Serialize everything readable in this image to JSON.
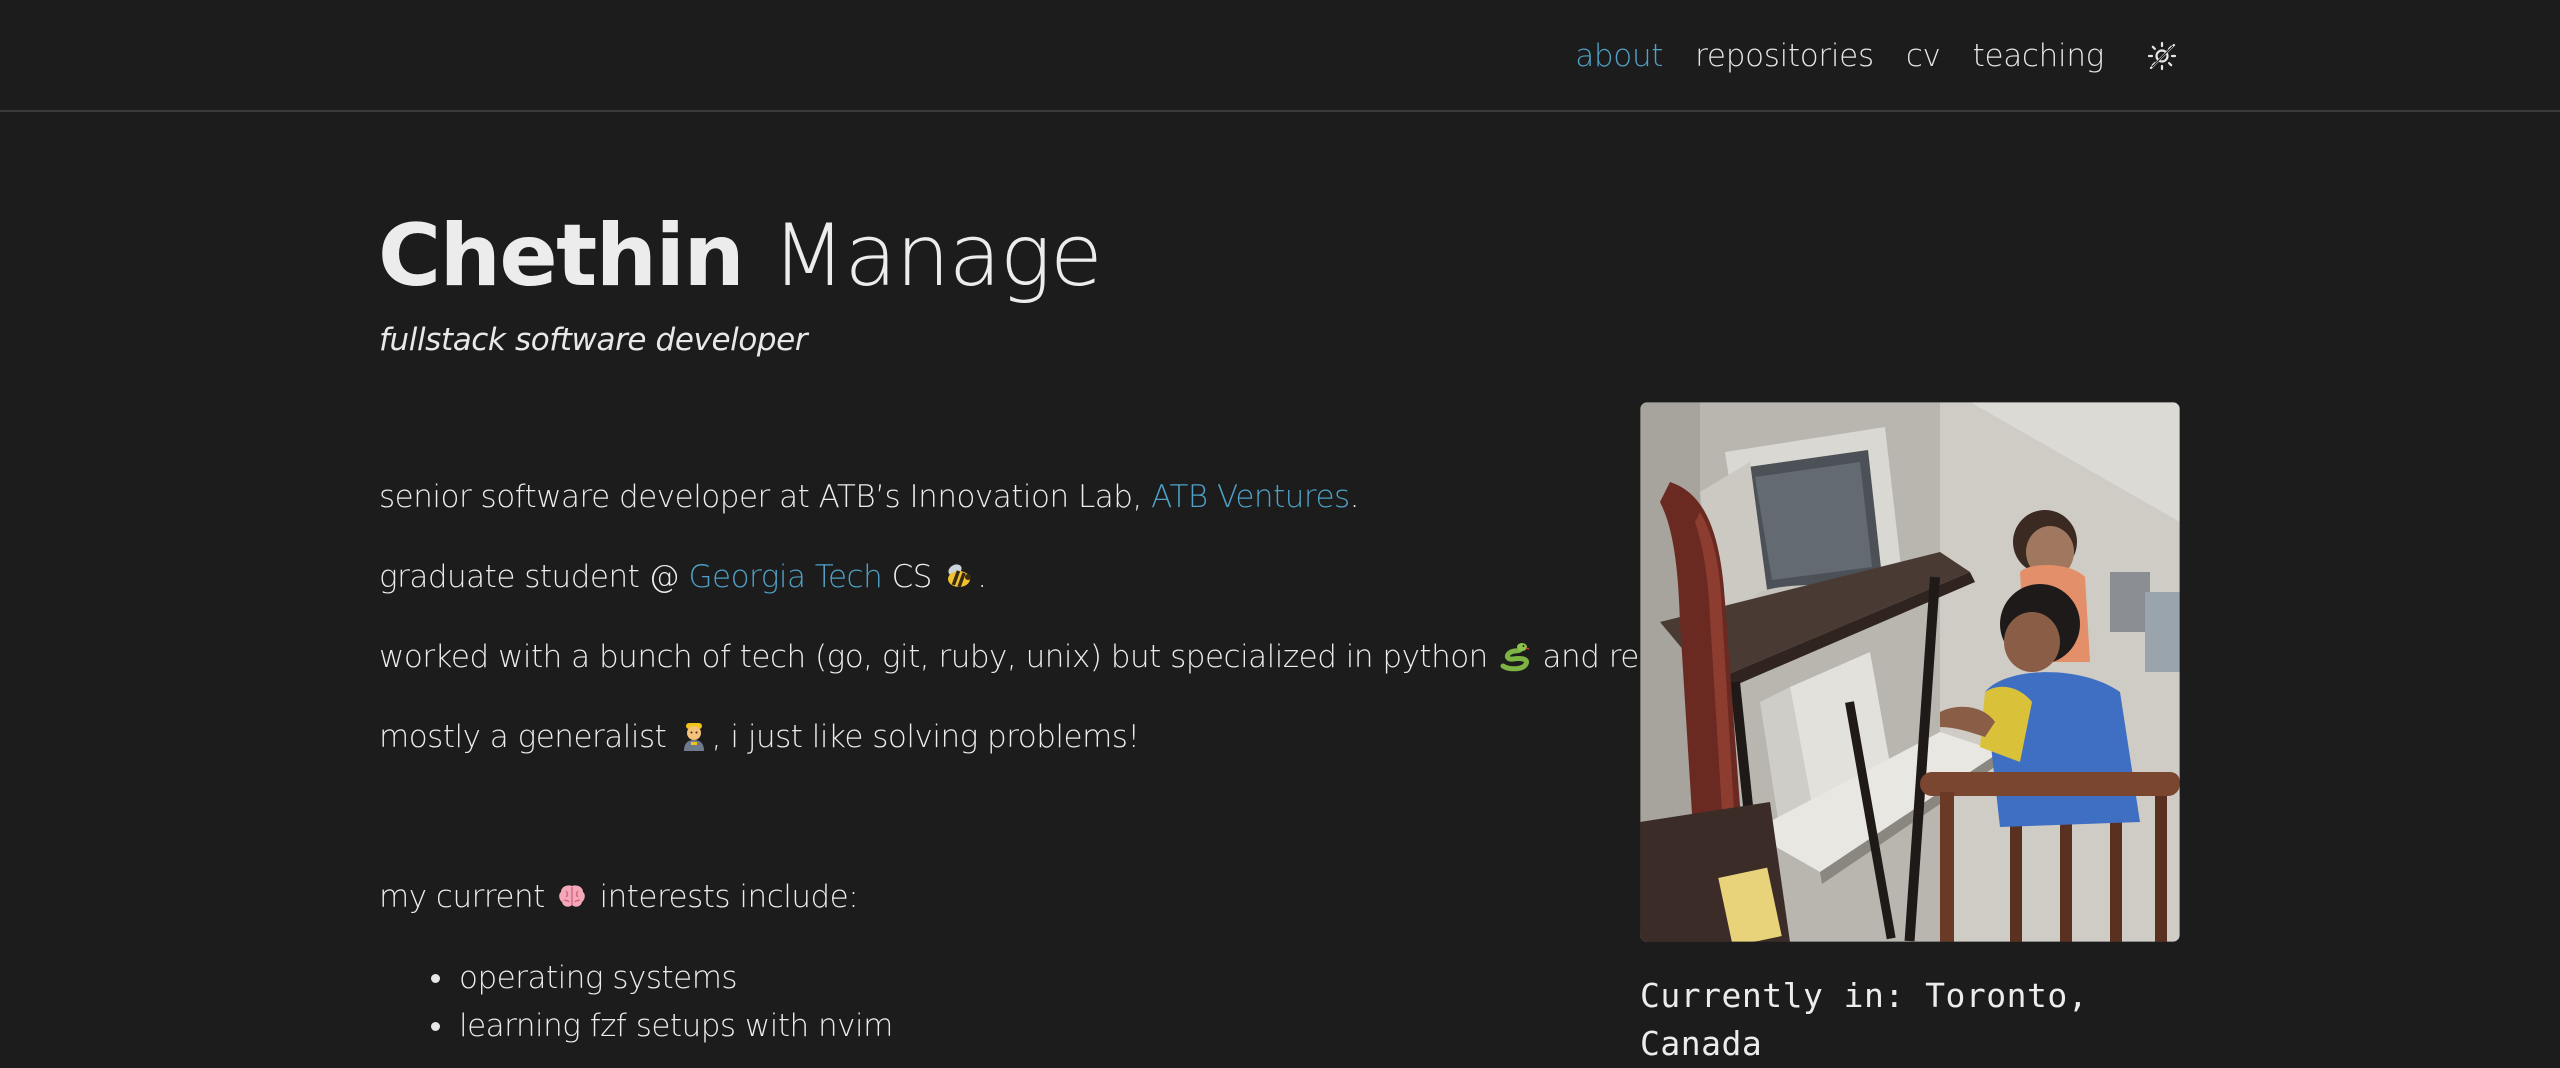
{
  "nav": {
    "items": [
      {
        "label": "about",
        "active": true
      },
      {
        "label": "repositories",
        "active": false
      },
      {
        "label": "cv",
        "active": false
      },
      {
        "label": "teaching",
        "active": false
      }
    ],
    "theme_toggle_icon": "theme-toggle-icon",
    "accent_color": "#4fa1c5"
  },
  "header": {
    "first_name": "Chethin",
    "last_name": "Manage",
    "subtitle": "fullstack software developer"
  },
  "bio": {
    "line1_text": "senior software developer at ATB’s Innovation Lab, ",
    "line1_link": "ATB Ventures",
    "line1_end": ".",
    "line2_text": "graduate student @ ",
    "line2_link": "Georgia Tech",
    "line2_mid": " CS ",
    "line2_end": ".",
    "line3_text": "worked with a bunch of tech (go, git, ruby, unix) but specialized in python ",
    "line3_end": " and react.",
    "line4_text": "mostly a generalist ",
    "line4_end": ", i just like solving problems!",
    "interests_text": "my current ",
    "interests_end": " interests include:",
    "interests": [
      "operating systems",
      "learning fzf setups with nvim"
    ]
  },
  "sidebar": {
    "location": "Currently in: Toronto, Canada"
  }
}
